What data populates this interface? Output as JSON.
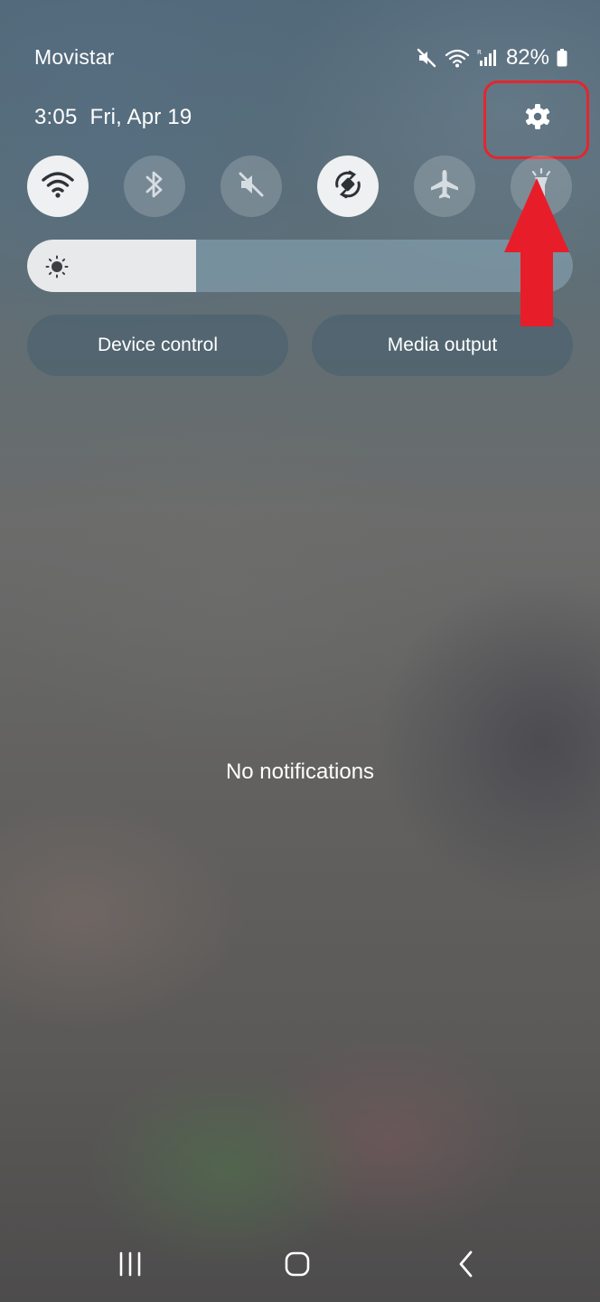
{
  "status_bar": {
    "carrier": "Movistar",
    "battery_percent": "82%",
    "icons": [
      "mute-icon",
      "wifi-icon",
      "signal-icon",
      "battery-icon"
    ]
  },
  "header": {
    "time": "3:05",
    "date": "Fri, Apr 19",
    "settings_icon": "gear-icon"
  },
  "quick_settings": [
    {
      "name": "wifi",
      "icon": "wifi-icon",
      "active": true
    },
    {
      "name": "bluetooth",
      "icon": "bluetooth-icon",
      "active": false
    },
    {
      "name": "sound",
      "icon": "mute-icon",
      "active": false
    },
    {
      "name": "auto-rotate",
      "icon": "auto-rotate-icon",
      "active": true
    },
    {
      "name": "airplane-mode",
      "icon": "airplane-icon",
      "active": false
    },
    {
      "name": "flashlight",
      "icon": "flashlight-icon",
      "active": false
    }
  ],
  "brightness": {
    "level": 0.31,
    "icon": "sun-icon"
  },
  "panel_buttons": {
    "device_control": "Device control",
    "media_output": "Media output"
  },
  "notifications": {
    "empty_text": "No notifications"
  },
  "nav_bar": {
    "icons": [
      "recent-apps-icon",
      "home-icon",
      "back-icon"
    ]
  },
  "annotation": {
    "highlight_color": "#e3262f",
    "arrow_color": "#e81d2a"
  }
}
